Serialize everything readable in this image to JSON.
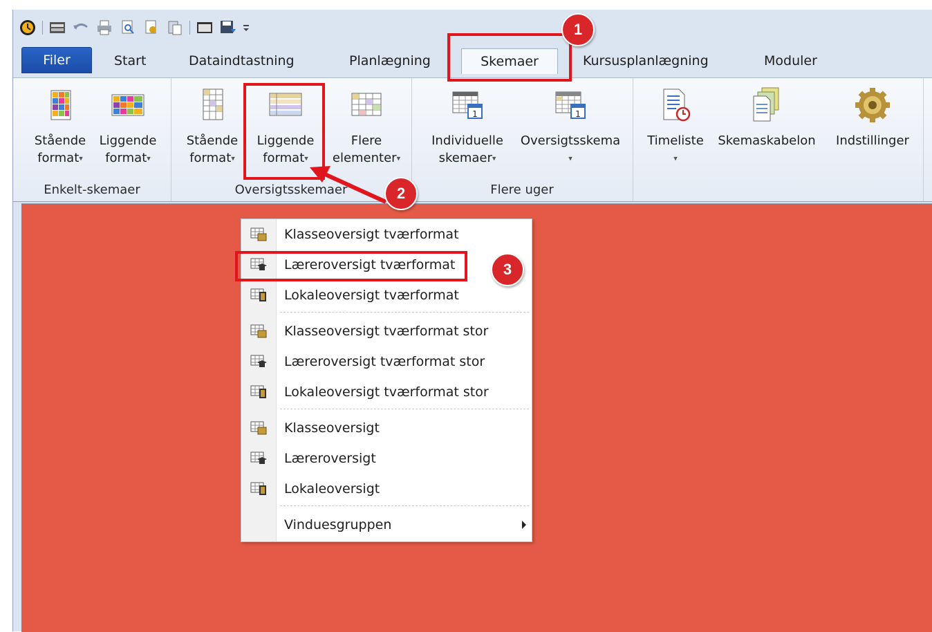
{
  "quick_access": {
    "icons": [
      "clock-icon",
      "open-icon",
      "undo-icon",
      "print-icon",
      "print-preview-icon",
      "settings-icon",
      "paste-icon",
      "window-icon",
      "save-icon",
      "customize-icon"
    ]
  },
  "tabs": [
    {
      "label": "Filer"
    },
    {
      "label": "Start"
    },
    {
      "label": "Dataindtastning"
    },
    {
      "label": "Planlægning"
    },
    {
      "label": "Skemaer"
    },
    {
      "label": "Kursusplanlægning"
    },
    {
      "label": "Moduler"
    }
  ],
  "ribbon": {
    "groups": [
      {
        "label": "Enkelt-skemaer"
      },
      {
        "label": "Oversigtsskemaer"
      },
      {
        "label": "Flere uger"
      }
    ],
    "buttons": {
      "staaende1": [
        "Stående",
        "format"
      ],
      "liggende1": [
        "Liggende",
        "format"
      ],
      "staaende2": [
        "Stående",
        "format"
      ],
      "liggende2": [
        "Liggende",
        "format"
      ],
      "flere": [
        "Flere",
        "elementer"
      ],
      "individuelle": [
        "Individuelle",
        "skemaer"
      ],
      "oversigtsskema": [
        "Oversigtsskema"
      ],
      "timeliste": [
        "Timeliste"
      ],
      "skemaskabelon": [
        "Skemaskabelon"
      ],
      "indstillinger": [
        "Indstillinger"
      ]
    }
  },
  "menu": {
    "items": [
      {
        "label": "Klasseoversigt tværformat"
      },
      {
        "label": "Læreroversigt tværformat"
      },
      {
        "label": "Lokaleoversigt tværformat"
      },
      {
        "label": "Klasseoversigt tværformat stor"
      },
      {
        "label": "Læreroversigt tværformat stor"
      },
      {
        "label": "Lokaleoversigt tværformat stor"
      },
      {
        "label": "Klasseoversigt"
      },
      {
        "label": "Læreroversigt"
      },
      {
        "label": "Lokaleoversigt"
      },
      {
        "label": "Vinduesgruppen"
      }
    ]
  },
  "annotations": {
    "badges": [
      "1",
      "2",
      "3"
    ],
    "highlight_color": "#e0161c"
  },
  "colors": {
    "workspace": "#e45a46",
    "file_tab": "#1f55b5"
  }
}
